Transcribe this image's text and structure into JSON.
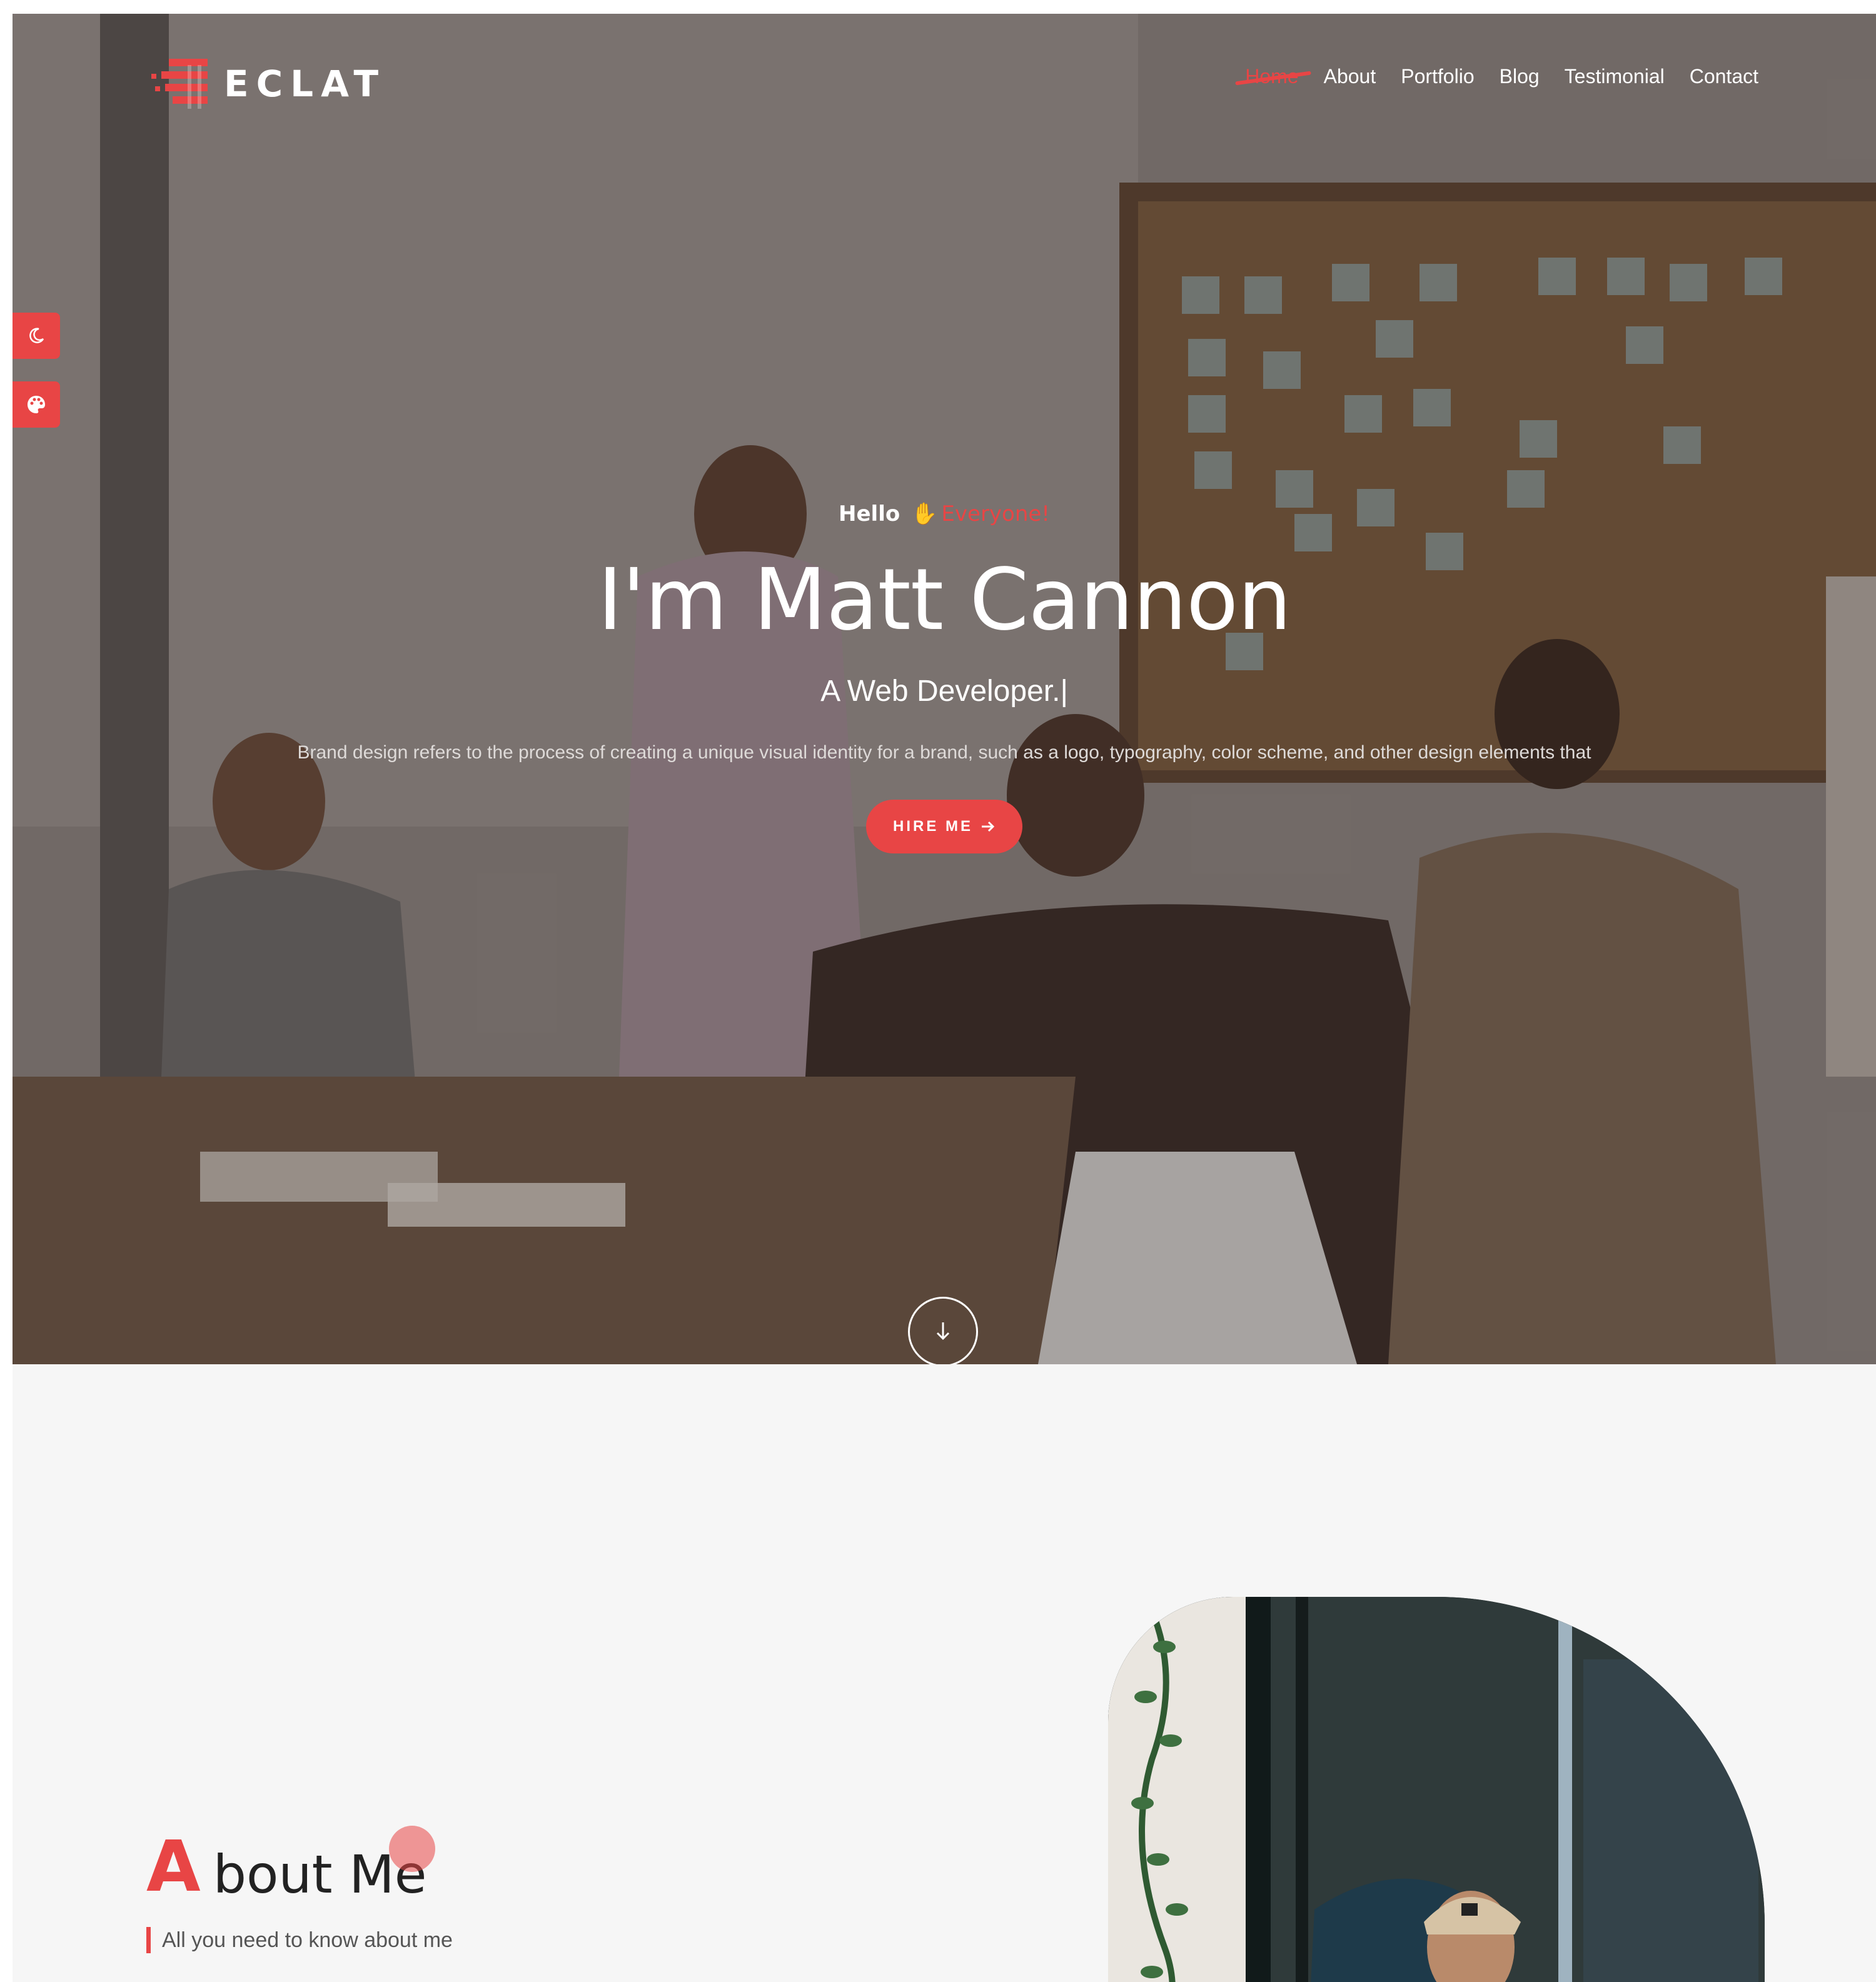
{
  "brand": {
    "name": "ECLAT",
    "accent": "#e84545"
  },
  "nav": {
    "items": [
      {
        "label": "Home",
        "active": true
      },
      {
        "label": "About"
      },
      {
        "label": "Portfolio"
      },
      {
        "label": "Blog"
      },
      {
        "label": "Testimonial"
      },
      {
        "label": "Contact"
      }
    ]
  },
  "sidebar": {
    "items": [
      {
        "icon": "moon-icon"
      },
      {
        "icon": "palette-icon"
      }
    ]
  },
  "hero": {
    "greeting": "Hello",
    "greeting_icon": "waving-hand-icon",
    "greeting_accent": "Everyone!",
    "name": "I'm Matt Cannon",
    "role": "A Web Developer.|",
    "description": "Brand design refers to the process of creating a unique visual identity for a brand, such as a logo, typography, color scheme, and other design elements that",
    "cta_label": "HIRE ME",
    "cta_icon": "arrow-right-icon",
    "scroll_icon": "arrow-down-icon"
  },
  "about": {
    "title_first_letter": "A",
    "title_rest": "bout Me",
    "subtitle": "All you need to know about me"
  }
}
